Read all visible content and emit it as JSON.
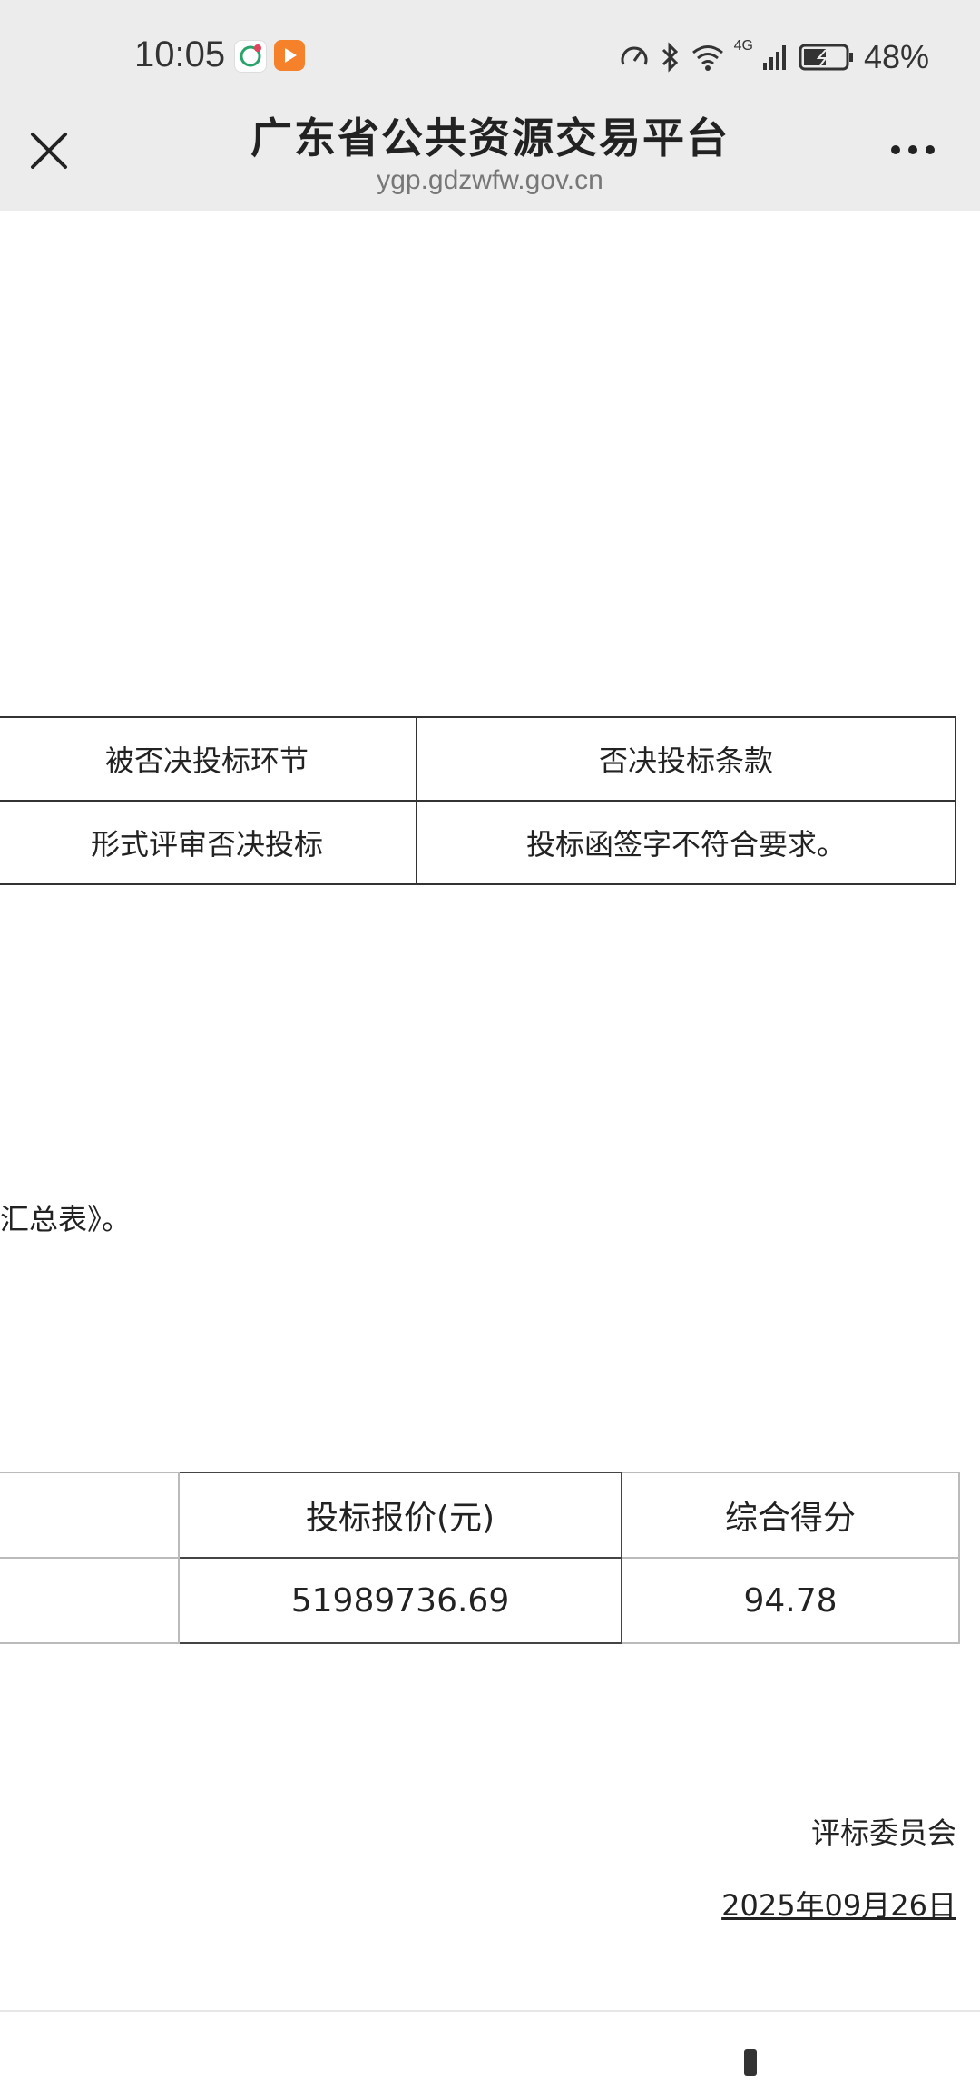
{
  "status_bar": {
    "time": "10:05",
    "network": "4G",
    "battery": "48%",
    "icons": [
      "app-icon",
      "video-app-icon",
      "data-saver-icon",
      "bluetooth-icon",
      "wifi-icon",
      "signal-icon",
      "battery-icon"
    ]
  },
  "browser": {
    "title": "广东省公共资源交易平台",
    "url": "ygp.gdzwfw.gov.cn"
  },
  "rejection_table": {
    "headers": [
      "被否决投标环节",
      "否决投标条款"
    ],
    "rows": [
      [
        "形式评审否决投标",
        "投标函签字不符合要求。"
      ]
    ]
  },
  "summary_note": "汇总表》。",
  "score_table": {
    "headers": [
      "",
      "投标报价(元)",
      "综合得分"
    ],
    "rows": [
      [
        "",
        "51989736.69",
        "94.78"
      ]
    ]
  },
  "signature": {
    "org": "评标委员会",
    "date": "2025年09月26日"
  },
  "colors": {
    "topbar_bg": "#ececec",
    "accent_orange": "#f5822b"
  }
}
